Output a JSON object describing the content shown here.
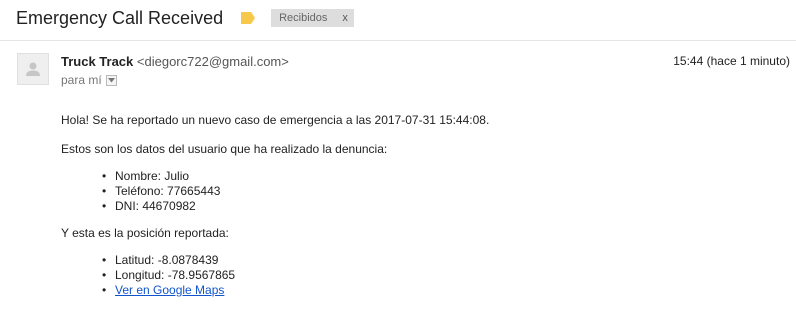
{
  "email": {
    "subject": "Emergency Call Received",
    "label_chip": {
      "text": "Recibidos",
      "remove": "x"
    },
    "sender": {
      "name": "Truck Track",
      "email": "<diegorc722@gmail.com>"
    },
    "recipient": "para mí",
    "timestamp": "15:44 (hace 1 minuto)",
    "body": {
      "intro": "Hola! Se ha reportado un nuevo caso de emergencia a las 2017-07-31 15:44:08.",
      "user_data_heading": "Estos son los datos del usuario que ha realizado la denuncia:",
      "user_data": [
        "Nombre: Julio",
        "Teléfono: 77665443",
        "DNI: 44670982"
      ],
      "position_heading": "Y esta es la posición reportada:",
      "position": [
        "Latitud: -8.0878439",
        "Longitud: -78.9567865"
      ],
      "maps_link": "Ver en Google Maps"
    }
  },
  "colors": {
    "link": "#1155cc",
    "label_tag": "#f6c94a",
    "chip_bg": "#dddddd"
  },
  "icons": {
    "label": "label-tag-icon",
    "avatar": "person-icon",
    "dropdown": "chevron-down-icon"
  }
}
